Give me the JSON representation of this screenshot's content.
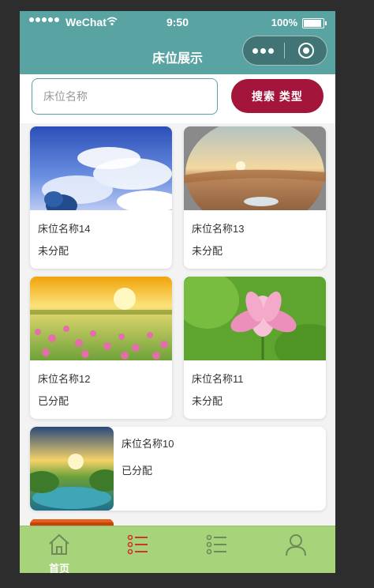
{
  "status_bar": {
    "carrier": "WeChat",
    "time": "9:50",
    "battery": "100%"
  },
  "nav": {
    "title": "床位展示"
  },
  "search": {
    "placeholder": "床位名称",
    "button_label": "搜索 类型"
  },
  "beds": [
    {
      "name": "床位名称14",
      "status": "未分配",
      "image": "sky-clouds"
    },
    {
      "name": "床位名称13",
      "status": "未分配",
      "image": "desert-sunset"
    },
    {
      "name": "床位名称12",
      "status": "已分配",
      "image": "flower-field-sunrise"
    },
    {
      "name": "床位名称11",
      "status": "未分配",
      "image": "lotus-flower"
    },
    {
      "name": "床位名称10",
      "status": "已分配",
      "image": "lake-sunset"
    }
  ],
  "tab_bar": {
    "items": [
      {
        "label": "首页",
        "icon": "home-icon"
      },
      {
        "label": "",
        "icon": "list-icon"
      },
      {
        "label": "",
        "icon": "list-outline-icon"
      },
      {
        "label": "",
        "icon": "user-icon"
      }
    ]
  },
  "colors": {
    "header": "#5aa3a3",
    "search_button": "#a3153a",
    "tab_bar": "#a7d47a",
    "tab_active_icon": "#d0342c"
  }
}
